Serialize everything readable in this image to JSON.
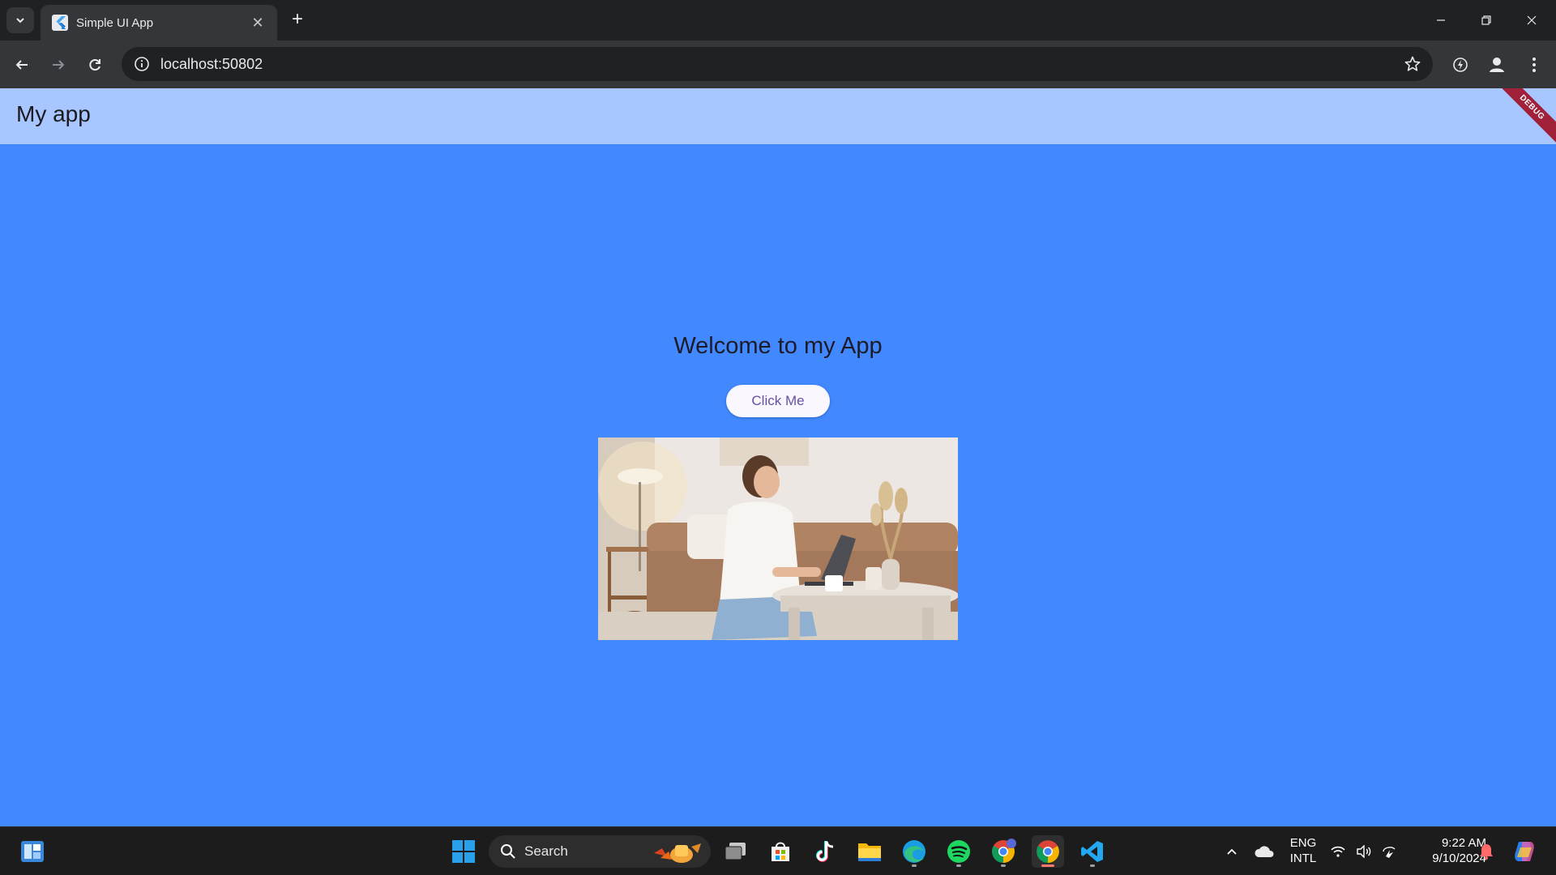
{
  "browser": {
    "tab_title": "Simple UI App",
    "url": "localhost:50802"
  },
  "app": {
    "appbar_title": "My app",
    "debug_banner": "DEBUG",
    "welcome_text": "Welcome to my App",
    "button_label": "Click Me",
    "colors": {
      "background": "#4288ff",
      "appbar": "#a8c6ff",
      "button_text": "#6750a4"
    }
  },
  "taskbar": {
    "search_label": "Search",
    "language_line1": "ENG",
    "language_line2": "INTL",
    "time": "9:22 AM",
    "date": "9/10/2024",
    "icons": [
      "widgets-icon",
      "windows-start-icon",
      "search-icon",
      "task-view-icon",
      "microsoft-store-icon",
      "tiktok-icon",
      "file-explorer-icon",
      "edge-icon",
      "spotify-icon",
      "chrome-profile-icon",
      "chrome-icon",
      "vscode-icon"
    ]
  }
}
